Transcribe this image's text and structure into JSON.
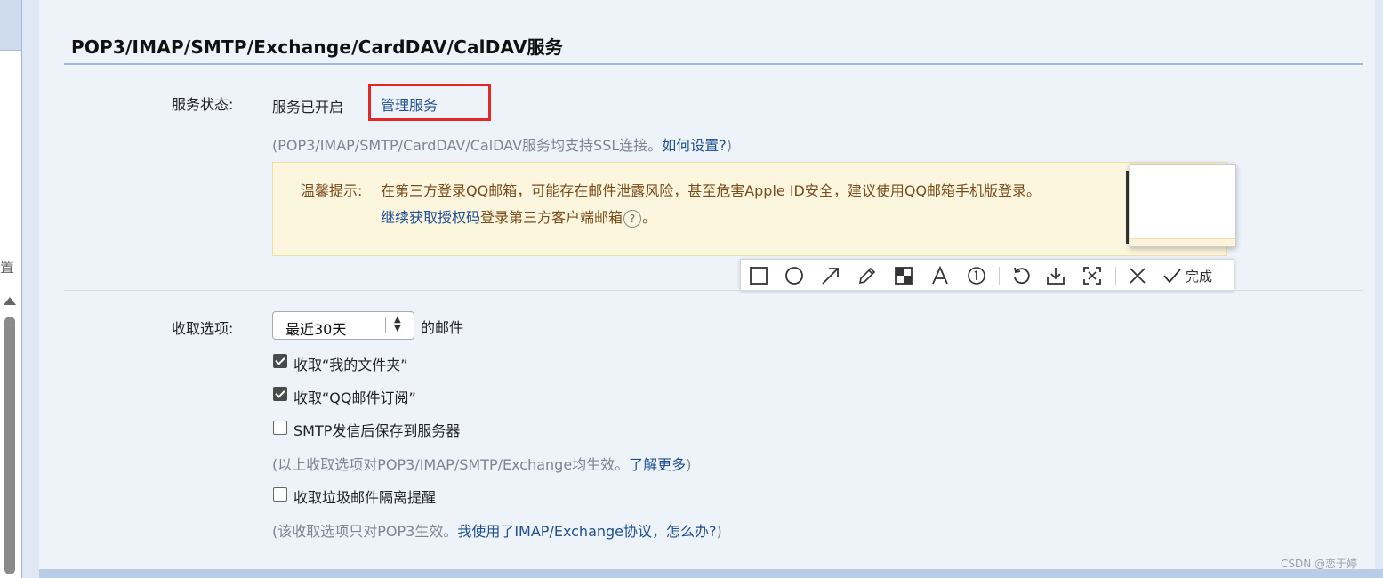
{
  "section": {
    "title": "POP3/IMAP/SMTP/Exchange/CardDAV/CalDAV服务"
  },
  "left_strip": {
    "cut_char": "置"
  },
  "service_status": {
    "label": "服务状态:",
    "value": "服务已开启",
    "manage_link": "管理服务",
    "note_prefix": "(POP3/IMAP/SMTP/CardDAV/CalDAV服务均支持SSL连接。",
    "note_link": "如何设置?",
    "note_suffix": ")"
  },
  "tip": {
    "label": "温馨提示:",
    "line1": "在第三方登录QQ邮箱，可能存在邮件泄露风险，甚至危害Apple ID安全，建议使用QQ邮箱手机版登录。",
    "line2_link": "继续获取授权码",
    "line2_text": "登录第三方客户端邮箱",
    "help_icon": "?",
    "line2_end": "。"
  },
  "toolbar": {
    "icons": [
      "rectangle-icon",
      "ellipse-icon",
      "arrow-icon",
      "pencil-icon",
      "mosaic-icon",
      "text-icon",
      "number-icon",
      "undo-icon",
      "download-icon",
      "ocr-icon",
      "close-icon",
      "check-icon"
    ],
    "done_label": "完成"
  },
  "fetch_options": {
    "label": "收取选项:",
    "select_value": "最近30天",
    "select_suffix": "的邮件",
    "options": [
      {
        "label": "收取“我的文件夹”",
        "checked": true
      },
      {
        "label": "收取“QQ邮件订阅”",
        "checked": true
      },
      {
        "label": "SMTP发信后保存到服务器",
        "checked": false
      }
    ],
    "note1_prefix": "(以上收取选项对POP3/IMAP/SMTP/Exchange均生效。",
    "note1_link": "了解更多",
    "note1_suffix": ")",
    "spam_option": {
      "label": "收取垃圾邮件隔离提醒",
      "checked": false
    },
    "note2_prefix": "(该收取选项只对POP3生效。",
    "note2_link": "我使用了IMAP/Exchange协议，怎么办?",
    "note2_suffix": ")"
  },
  "watermark": "CSDN @恋于婷"
}
